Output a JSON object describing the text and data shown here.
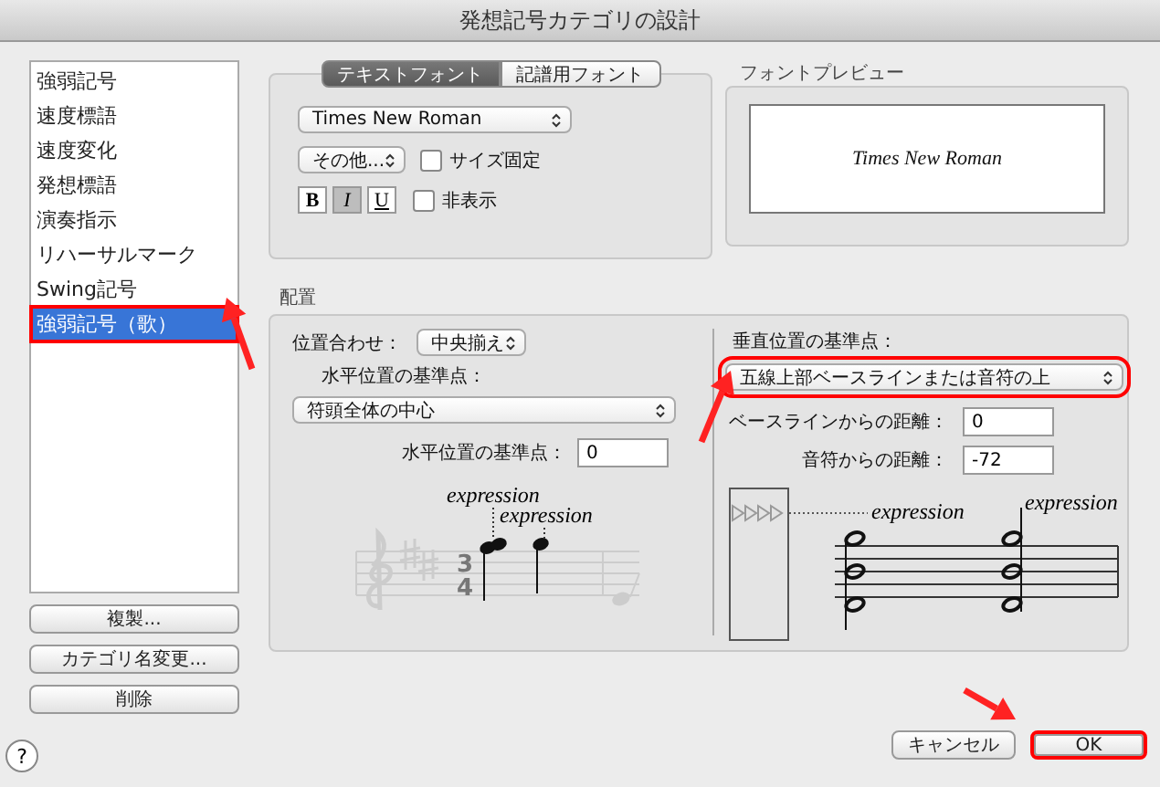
{
  "window": {
    "title": "発想記号カテゴリの設計"
  },
  "categories": [
    {
      "label": "強弱記号",
      "selected": false,
      "highlighted": false
    },
    {
      "label": "速度標語",
      "selected": false,
      "highlighted": false
    },
    {
      "label": "速度変化",
      "selected": false,
      "highlighted": false
    },
    {
      "label": "発想標語",
      "selected": false,
      "highlighted": false
    },
    {
      "label": "演奏指示",
      "selected": false,
      "highlighted": false
    },
    {
      "label": "リハーサルマーク",
      "selected": false,
      "highlighted": false
    },
    {
      "label": "Swing記号",
      "selected": false,
      "highlighted": false
    },
    {
      "label": "強弱記号（歌）",
      "selected": true,
      "highlighted": true
    }
  ],
  "category_buttons": [
    "複製...",
    "カテゴリ名変更...",
    "削除"
  ],
  "font_tabs": [
    {
      "label": "テキストフォント",
      "selected": true
    },
    {
      "label": "記譜用フォント",
      "selected": false
    }
  ],
  "font": {
    "family": "Times New Roman",
    "size": "その他...",
    "fixed_size": {
      "label": "サイズ固定",
      "checked": false
    },
    "styles": [
      {
        "label": "B",
        "kind": "bold",
        "on": false
      },
      {
        "label": "I",
        "kind": "italic",
        "on": true
      },
      {
        "label": "U",
        "kind": "underline",
        "on": false
      }
    ],
    "hidden": {
      "label": "非表示",
      "checked": false
    }
  },
  "preview": {
    "title": "フォントプレビュー",
    "sample": "Times New Roman"
  },
  "placement": {
    "title": "配置",
    "alignment": {
      "label": "位置合わせ：",
      "value": "中央揃え"
    },
    "horizontal_reference": {
      "label": "水平位置の基準点：",
      "value": "符頭全体の中心"
    },
    "horizontal_offset": {
      "label": "水平位置の基準点：",
      "value": "0"
    },
    "left_example": {
      "texts": [
        "expression",
        "expression"
      ],
      "time_signature": [
        "3",
        "4"
      ]
    },
    "vertical_reference": {
      "label": "垂直位置の基準点：",
      "value": "五線上部ベースラインまたは音符の上",
      "highlighted": true
    },
    "baseline_distance": {
      "label": "ベースラインからの距離：",
      "value": "0"
    },
    "note_distance": {
      "label": "音符からの距離：",
      "value": "-72"
    },
    "right_example": {
      "texts": [
        "expression",
        "expression"
      ]
    }
  },
  "help": "?",
  "dialog_buttons": [
    {
      "label": "キャンセル",
      "highlighted": false
    },
    {
      "label": "OK",
      "highlighted": true
    }
  ]
}
